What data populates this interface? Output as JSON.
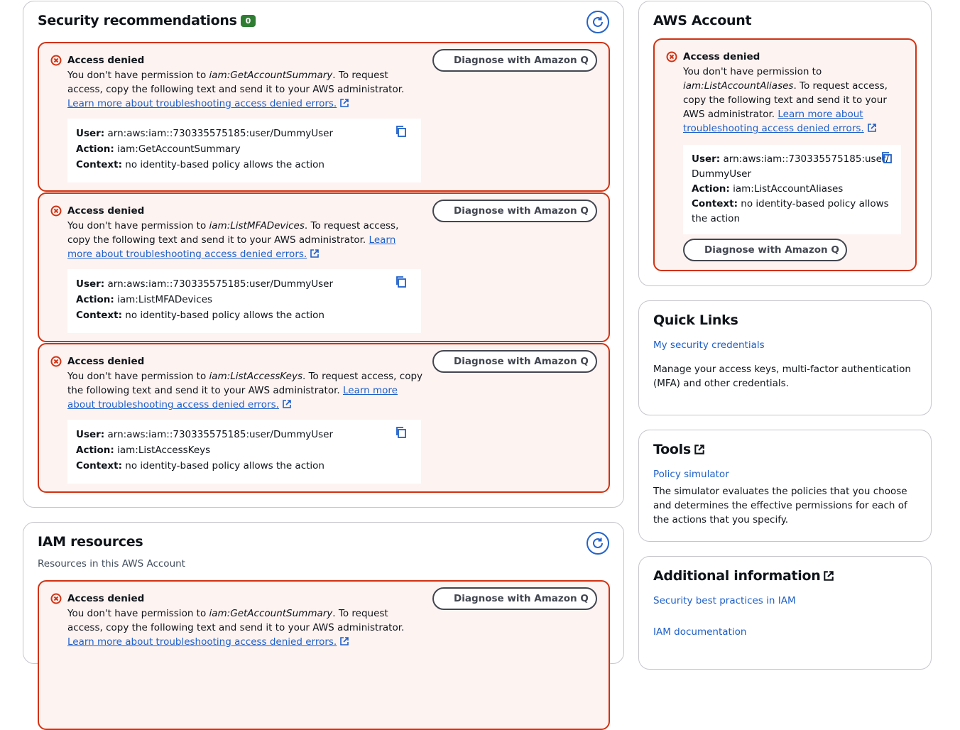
{
  "security": {
    "title": "Security recommendations",
    "badge": "0",
    "alerts": [
      {
        "title": "Access denied",
        "msg_prefix": "You don't have permission to ",
        "permission": "iam:GetAccountSummary",
        "msg_suffix": ". To request access, copy the following text and send it to your AWS administrator. ",
        "link": "Learn more about troubleshooting access denied errors.",
        "user_label": "User:",
        "user": "arn:aws:iam::730335575185:user/DummyUser",
        "action_label": "Action:",
        "action": "iam:GetAccountSummary",
        "context_label": "Context:",
        "context": "no identity-based policy allows the action",
        "diagnose": "Diagnose with Amazon Q"
      },
      {
        "title": "Access denied",
        "msg_prefix": "You don't have permission to ",
        "permission": "iam:ListMFADevices",
        "msg_suffix": ". To request access, copy the following text and send it to your AWS administrator. ",
        "link": "Learn more about troubleshooting access denied errors.",
        "user_label": "User:",
        "user": "arn:aws:iam::730335575185:user/DummyUser",
        "action_label": "Action:",
        "action": "iam:ListMFADevices",
        "context_label": "Context:",
        "context": "no identity-based policy allows the action",
        "diagnose": "Diagnose with Amazon Q"
      },
      {
        "title": "Access denied",
        "msg_prefix": "You don't have permission to ",
        "permission": "iam:ListAccessKeys",
        "msg_suffix": ". To request access, copy the following text and send it to your AWS administrator. ",
        "link": "Learn more about troubleshooting access denied errors.",
        "user_label": "User:",
        "user": "arn:aws:iam::730335575185:user/DummyUser",
        "action_label": "Action:",
        "action": "iam:ListAccessKeys",
        "context_label": "Context:",
        "context": "no identity-based policy allows the action",
        "diagnose": "Diagnose with Amazon Q"
      }
    ]
  },
  "iam_resources": {
    "title": "IAM resources",
    "subtitle": "Resources in this AWS Account",
    "alert": {
      "title": "Access denied",
      "msg_prefix": "You don't have permission to ",
      "permission": "iam:GetAccountSummary",
      "msg_suffix": ". To request access, copy the following text and send it to your AWS administrator. ",
      "link": "Learn more about troubleshooting access denied errors.",
      "diagnose": "Diagnose with Amazon Q"
    }
  },
  "aws_account": {
    "title": "AWS Account",
    "alert": {
      "title": "Access denied",
      "msg_prefix": "You don't have permission to ",
      "permission": "iam:ListAccountAliases",
      "msg_suffix": ". To request access, copy the following text and send it to your AWS administrator. ",
      "link": "Learn more about troubleshooting access denied errors.",
      "user_label": "User:",
      "user": "arn:aws:iam::730335575185:user/DummyUser",
      "action_label": "Action:",
      "action": "iam:ListAccountAliases",
      "context_label": "Context:",
      "context": "no identity-based policy allows the action",
      "diagnose": "Diagnose with Amazon Q"
    }
  },
  "quick_links": {
    "title": "Quick Links",
    "link": "My security credentials",
    "desc": "Manage your access keys, multi-factor authentication (MFA) and other credentials."
  },
  "tools": {
    "title": "Tools",
    "link": "Policy simulator",
    "desc": "The simulator evaluates the policies that you choose and determines the effective permissions for each of the actions that you specify."
  },
  "additional": {
    "title": "Additional information",
    "link1": "Security best practices in IAM",
    "link2": "IAM documentation"
  },
  "colors": {
    "error_border": "#d13212",
    "error_bg": "#fdf3f1",
    "link": "#1d5fc9",
    "badge": "#2e7d32"
  },
  "icons": [
    "error-icon",
    "copy-icon",
    "refresh-icon",
    "external-link-icon",
    "amazon-q-icon"
  ]
}
